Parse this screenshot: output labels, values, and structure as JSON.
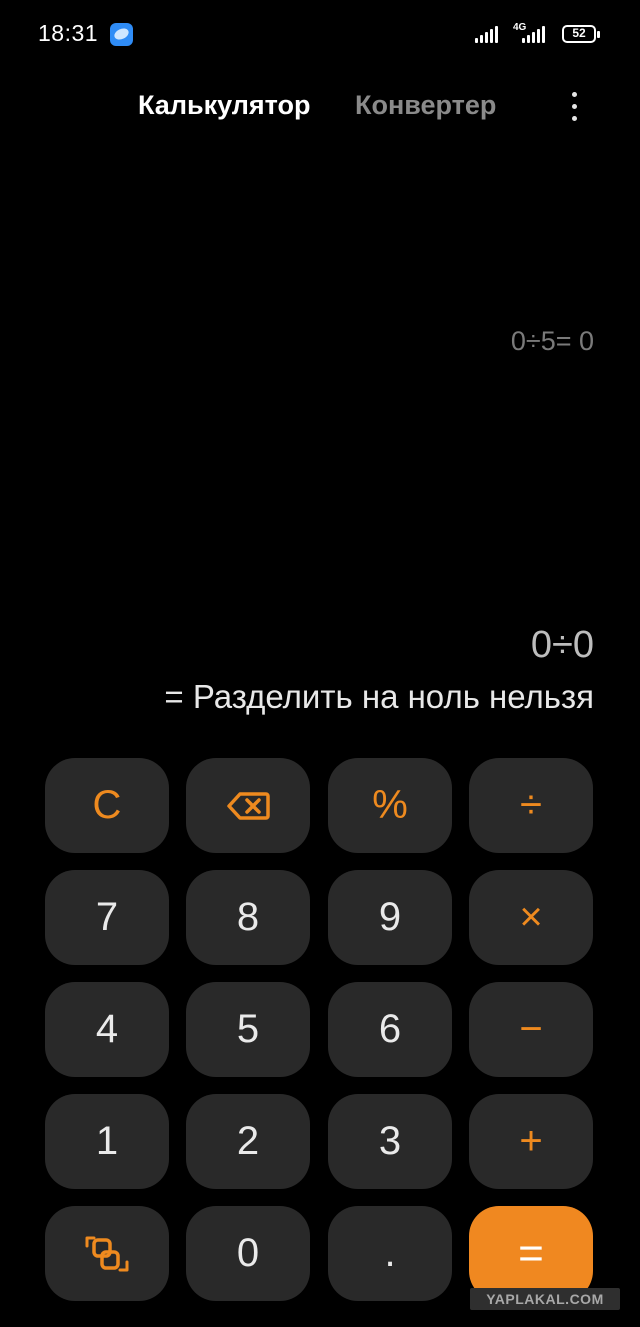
{
  "status_bar": {
    "time": "18:31",
    "network_type": "4G",
    "battery_level": "52",
    "notification_icon": "browser-planet-icon"
  },
  "tabs": [
    {
      "label": "Калькулятор",
      "active": true
    },
    {
      "label": "Конвертер",
      "active": false
    }
  ],
  "display": {
    "history": "0÷5= 0",
    "expression": "0÷0",
    "result": "= Разделить на ноль нельзя"
  },
  "keypad": {
    "rows": [
      [
        "C",
        "backspace-icon",
        "%",
        "÷"
      ],
      [
        "7",
        "8",
        "9",
        "×"
      ],
      [
        "4",
        "5",
        "6",
        "−"
      ],
      [
        "1",
        "2",
        "3",
        "+"
      ],
      [
        "switch-mode-icon",
        "0",
        ".",
        "="
      ]
    ],
    "labels": {
      "clear": "C",
      "percent": "%",
      "divide": "÷",
      "multiply": "×",
      "minus": "−",
      "plus": "+",
      "equals": "=",
      "dot": ".",
      "d0": "0",
      "d1": "1",
      "d2": "2",
      "d3": "3",
      "d4": "4",
      "d5": "5",
      "d6": "6",
      "d7": "7",
      "d8": "8",
      "d9": "9"
    }
  },
  "colors": {
    "background": "#000000",
    "key_background": "#292929",
    "accent": "#f08820",
    "operator_text": "#ee8a1f"
  },
  "watermark": "YAPLAKAL.COM"
}
